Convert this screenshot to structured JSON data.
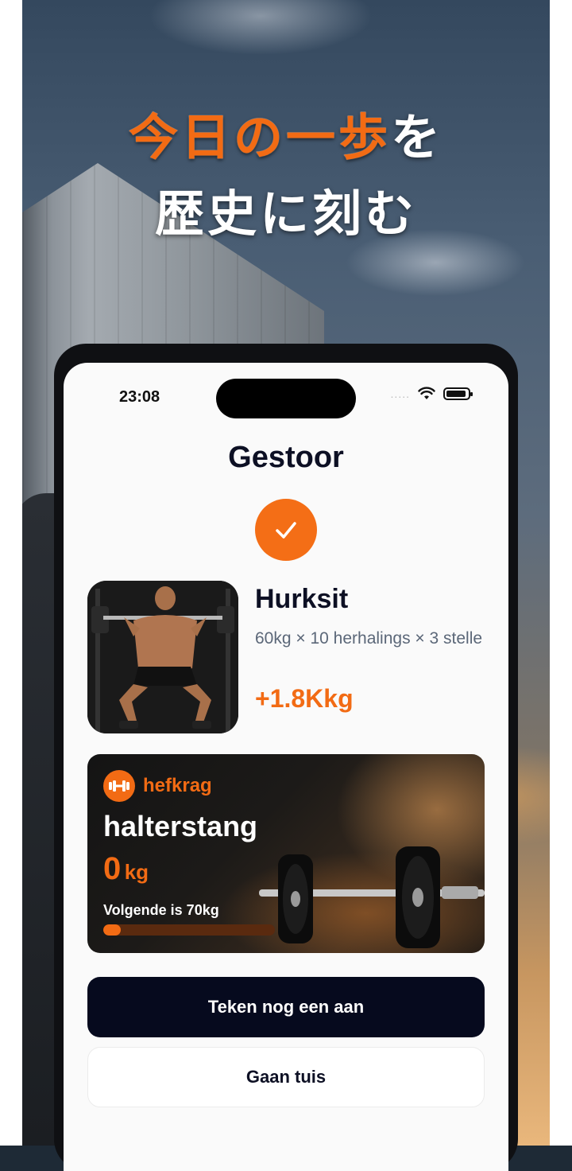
{
  "promo": {
    "headline_line1_accent": "今日の一歩",
    "headline_line1_rest": "を",
    "headline_line2": "歴史に刻む"
  },
  "status_bar": {
    "time": "23:08",
    "signal_dots": "....."
  },
  "screen": {
    "title": "Gestoor"
  },
  "exercise": {
    "name": "Hurksit",
    "detail": "60kg × 10 herhalings × 3 stelle",
    "gain": "+1.8Kkg"
  },
  "strength_card": {
    "label": "hefkrag",
    "title": "halterstang",
    "value": "0",
    "unit": "kg",
    "next": "Volgende is 70kg",
    "progress": 0.1
  },
  "buttons": {
    "primary": "Teken nog een aan",
    "secondary": "Gaan tuis"
  },
  "colors": {
    "accent": "#f26b14",
    "dark": "#060a1e"
  }
}
